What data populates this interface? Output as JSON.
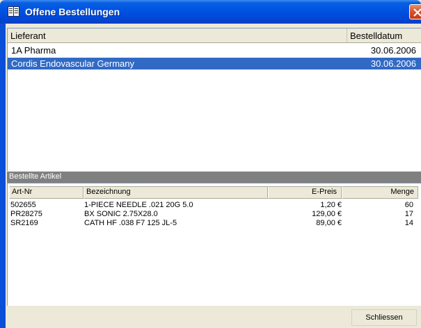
{
  "window": {
    "title": "Offene Bestellungen",
    "accent": "#0054e3",
    "selection_color": "#316ac5"
  },
  "orders": {
    "columns": [
      "Lieferant",
      "Bestelldatum"
    ],
    "rows": [
      {
        "lieferant": "1A Pharma",
        "datum": "30.06.2006",
        "selected": false
      },
      {
        "lieferant": "Cordis Endovascular Germany",
        "datum": "30.06.2006",
        "selected": true
      }
    ]
  },
  "articles": {
    "caption": "Bestellte Artikel",
    "columns": [
      "Art-Nr",
      "Bezeichnung",
      "E-Preis",
      "Menge"
    ],
    "rows": [
      {
        "artnr": "502655",
        "bezeichnung": "1-PIECE NEEDLE .021 20G 5.0",
        "epreis": "1,20 €",
        "menge": "60"
      },
      {
        "artnr": "PR28275",
        "bezeichnung": "BX SONIC 2.75X28.0",
        "epreis": "129,00 €",
        "menge": "17"
      },
      {
        "artnr": "SR2169",
        "bezeichnung": "CATH HF .038 F7 125 JL-5",
        "epreis": "89,00 €",
        "menge": "14"
      }
    ]
  },
  "buttons": {
    "close_label": "Schliessen"
  },
  "icons": {
    "title_icon": "book-icon",
    "close_icon": "close-icon"
  }
}
